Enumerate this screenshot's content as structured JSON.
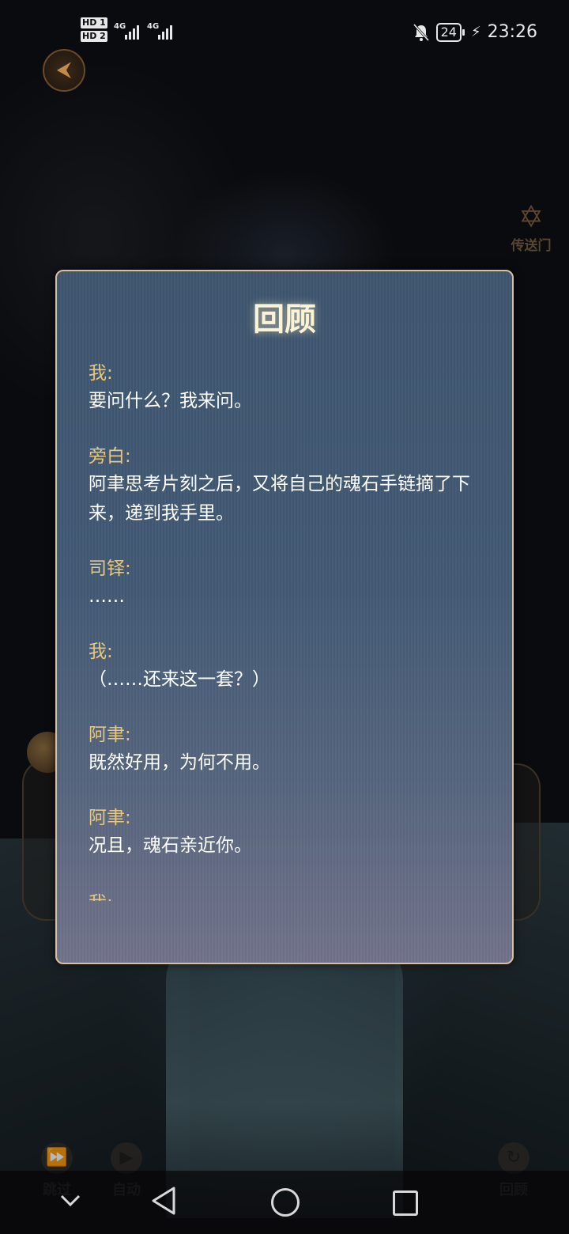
{
  "status_bar": {
    "hd1": "HD 1",
    "hd2": "HD 2",
    "net1": "4G",
    "net2": "4G",
    "battery": "24",
    "time": "23:26"
  },
  "top": {
    "back_icon": "back-arrow-icon",
    "portal_label": "传送门",
    "portal_icon": "hexagram-icon"
  },
  "dialog": {
    "title": "回顾",
    "entries": [
      {
        "speaker": "我:",
        "text": "要问什么？我来问。"
      },
      {
        "speaker": "旁白:",
        "text": "阿聿思考片刻之后，又将自己的魂石手链摘了下来，递到我手里。"
      },
      {
        "speaker": "司铎:",
        "text": "……"
      },
      {
        "speaker": "我:",
        "text": "（……还来这一套？）"
      },
      {
        "speaker": "阿聿:",
        "text": "既然好用，为何不用。"
      },
      {
        "speaker": "阿聿:",
        "text": "况且，魂石亲近你。"
      }
    ],
    "next_speaker_partial": "我:"
  },
  "game_buttons": {
    "skip": "跳过",
    "auto": "自动",
    "review": "回顾"
  },
  "colors": {
    "speaker": "#e8c77a",
    "panel_border": "#d8c09a",
    "panel_top": "#3f5670",
    "panel_bottom": "#72738a"
  }
}
